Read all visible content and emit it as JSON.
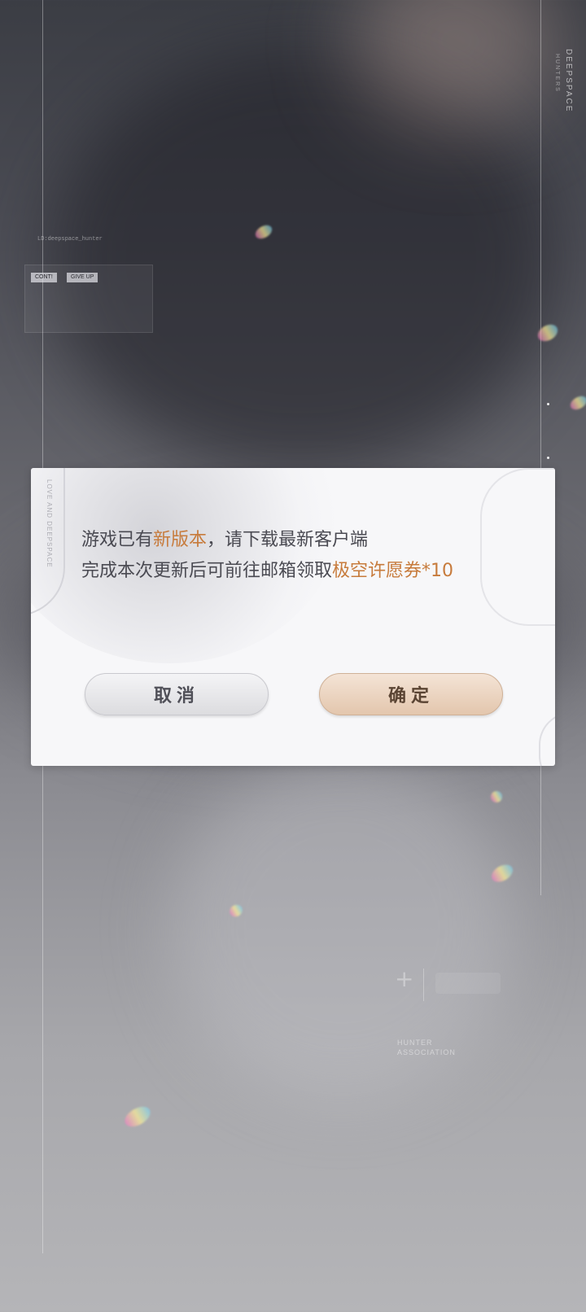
{
  "background": {
    "brand_vertical": "DEEPSPACE",
    "brand_vertical_sub": "HUNTERS",
    "deco_buttons": [
      "CONT!",
      "GIVE UP"
    ],
    "deco_tiny_text": "LD:deepspace_hunter",
    "hunter_association": [
      "HUNTER",
      "ASSOCIATION"
    ]
  },
  "dialog": {
    "side_brand": "LOVE AND DEEPSPACE",
    "line1": {
      "before": "游戏已有",
      "highlight": "新版本",
      "after": "，请下载最新客户端"
    },
    "line2": {
      "before": "完成本次更新后可前往邮箱领取",
      "highlight": "极空许愿券",
      "after": "*10"
    },
    "cancel_label": "取消",
    "confirm_label": "确定"
  },
  "colors": {
    "highlight": "#c77b3c",
    "body_text": "#4a4a52",
    "dialog_bg": "#f7f7f9"
  }
}
